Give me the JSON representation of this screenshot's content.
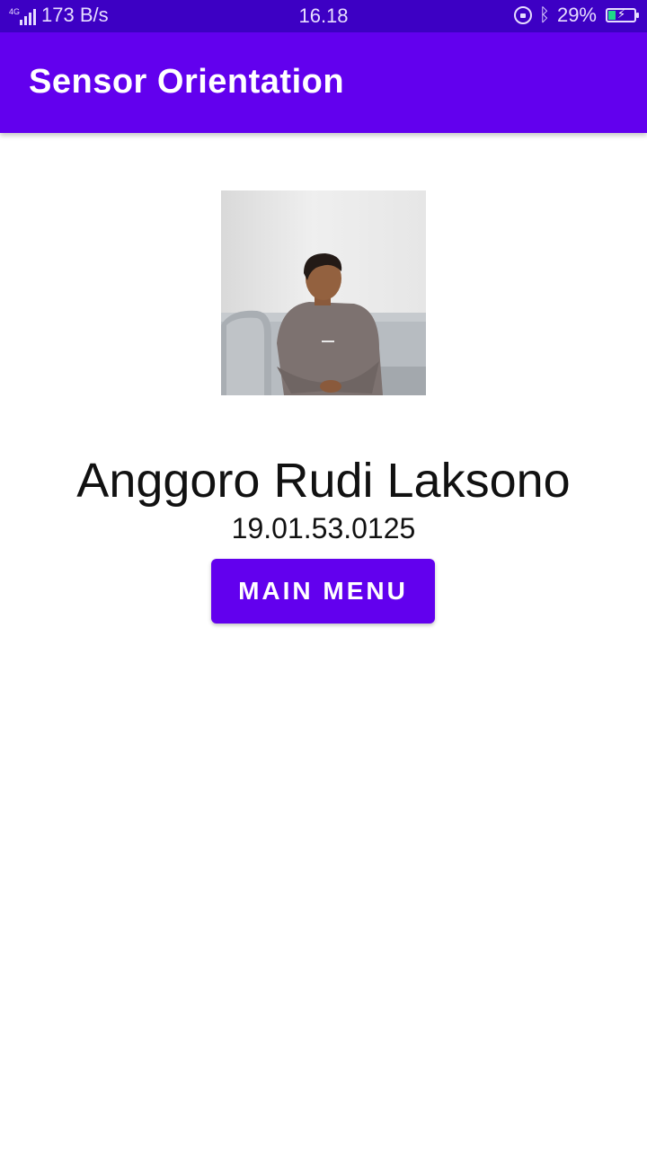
{
  "status_bar": {
    "network_type": "4G",
    "net_speed": "173 B/s",
    "time": "16.18",
    "battery": "29%",
    "icons": [
      "signal-icon",
      "screen-rotation-lock-icon",
      "bluetooth-icon",
      "battery-charging-icon"
    ]
  },
  "app_bar": {
    "title": "Sensor Orientation"
  },
  "profile": {
    "name": "Anggoro Rudi Laksono",
    "student_id": "19.01.53.0125",
    "photo": "profile-photo"
  },
  "actions": {
    "main_menu_label": "MAIN MENU"
  },
  "colors": {
    "status_bar": "#3d00c4",
    "primary": "#6200ee",
    "background": "#ffffff"
  }
}
